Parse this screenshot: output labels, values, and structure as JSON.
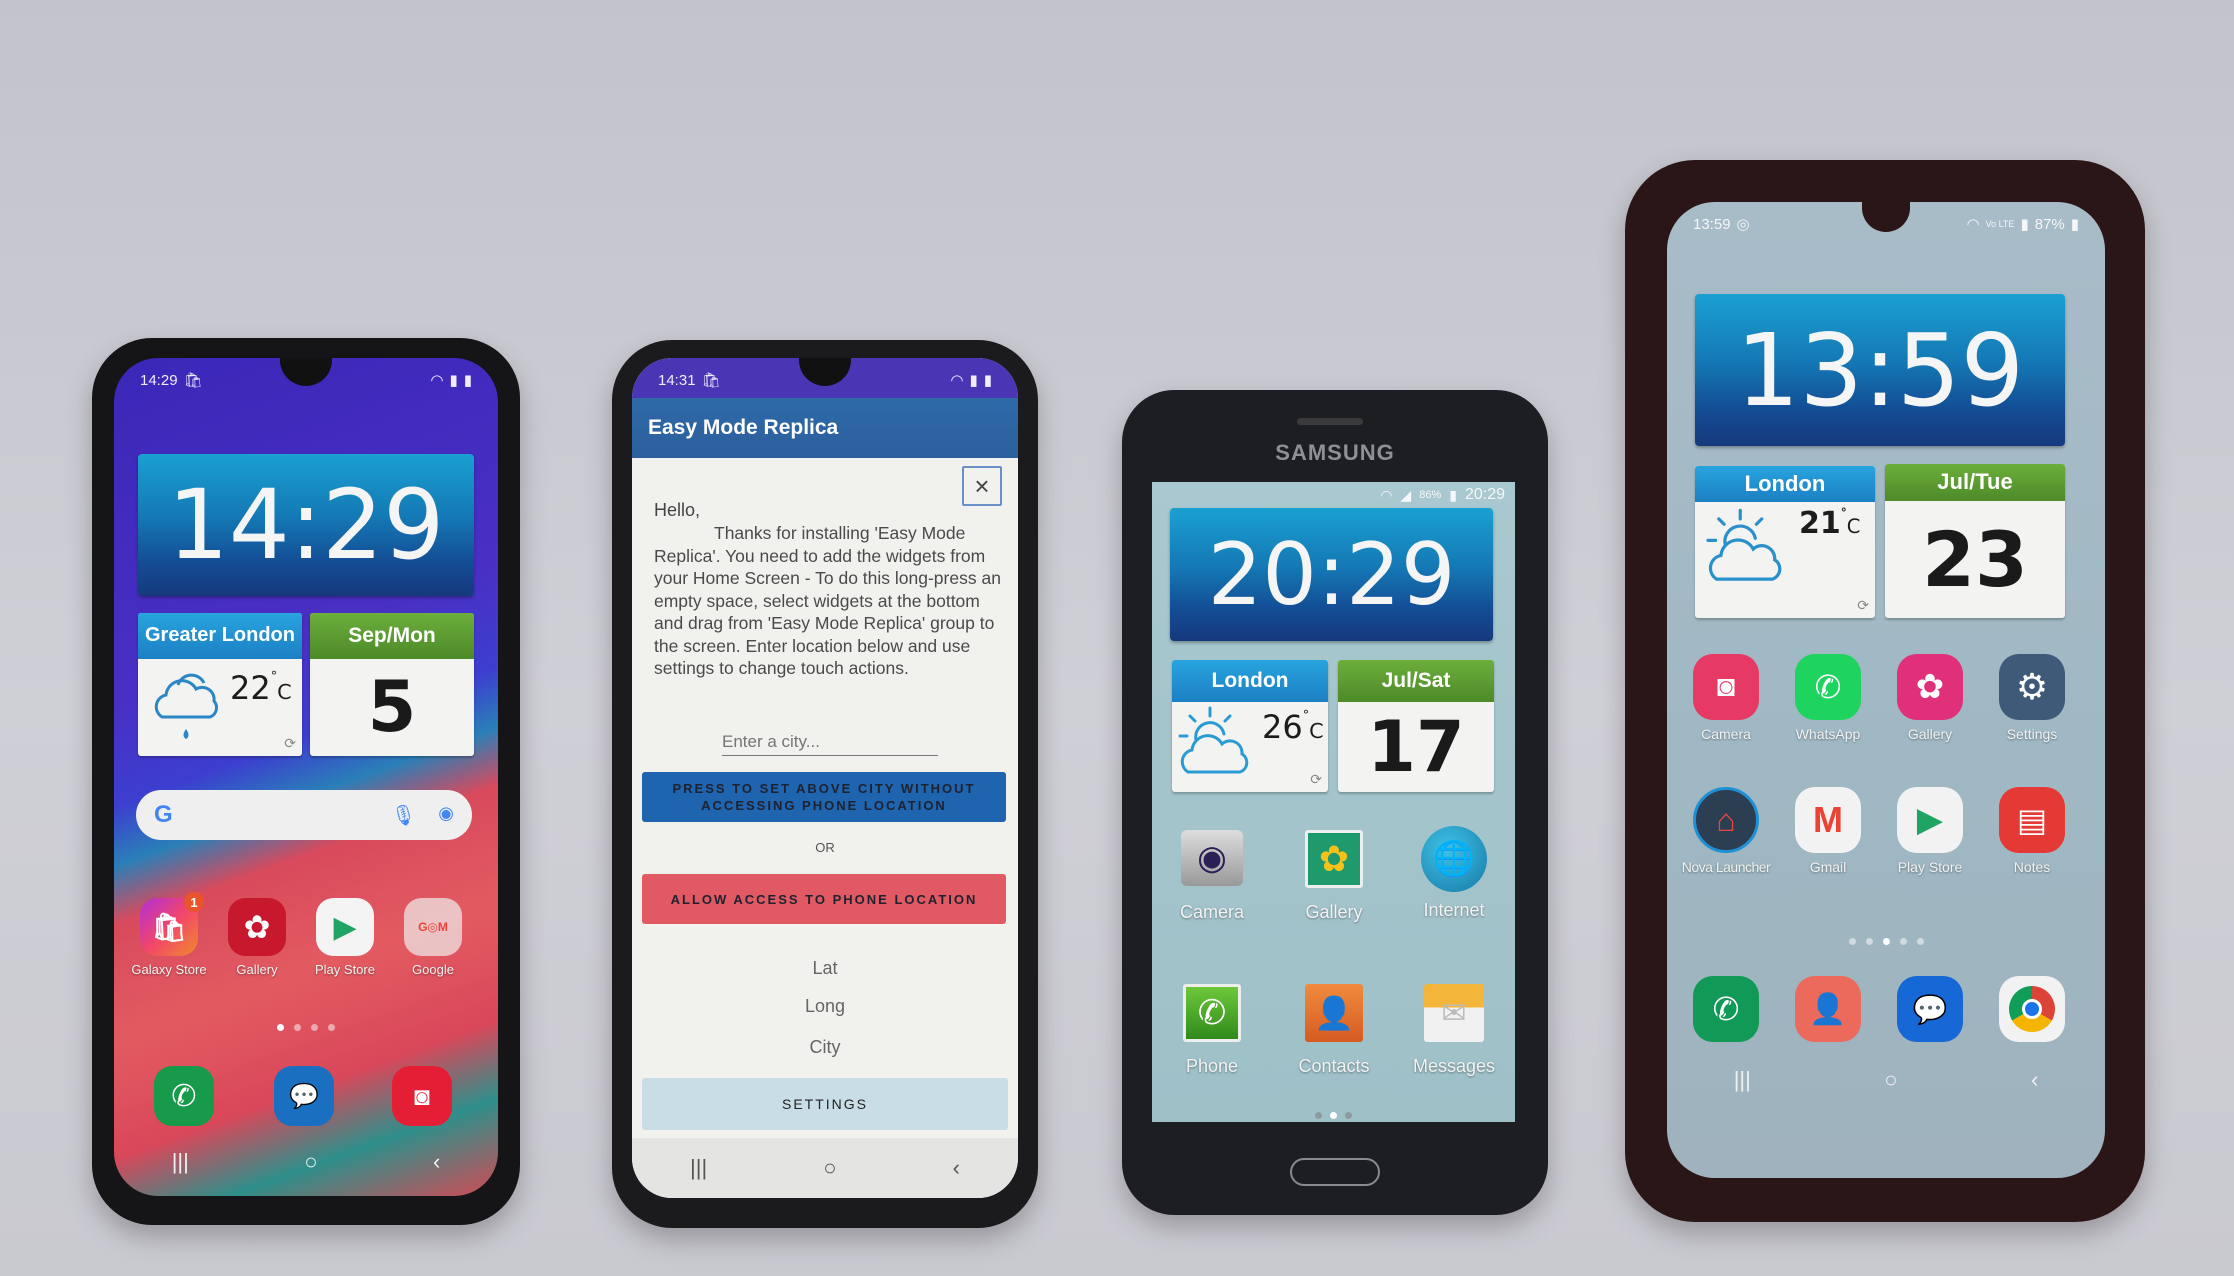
{
  "phones": [
    {
      "status": {
        "time": "14:29"
      },
      "clock": "14:29",
      "weather": {
        "location": "Greater London",
        "temp": "22",
        "unit": "C",
        "degree": "°",
        "condition": "rain-cloud-icon"
      },
      "calendar": {
        "header": "Sep/Mon",
        "day": "5"
      },
      "search": {
        "google_logo": "G"
      },
      "apps": [
        {
          "label": "Galaxy Store",
          "badge": "1"
        },
        {
          "label": "Gallery"
        },
        {
          "label": "Play Store"
        },
        {
          "label": "Google"
        }
      ],
      "dock": [
        "Phone",
        "Messages",
        "Camera"
      ],
      "nav": {
        "recents": "|||",
        "home": "○",
        "back": "‹"
      }
    },
    {
      "status": {
        "time": "14:31"
      },
      "app_title": "Easy Mode Replica",
      "close_label": "×",
      "greeting": "Hello,",
      "message": "Thanks for installing 'Easy Mode Replica'. You need to add the widgets from your Home Screen - To do this long-press an empty space, select widgets at the bottom and drag from 'Easy Mode Replica' group to the screen. Enter location below and use settings to change touch actions.",
      "city_input": {
        "placeholder": "Enter a city...",
        "value": ""
      },
      "set_city_button": "PRESS TO SET ABOVE CITY WITHOUT ACCESSING PHONE LOCATION",
      "or_label": "OR",
      "allow_location_button": "ALLOW ACCESS TO PHONE LOCATION",
      "lat_label": "Lat",
      "long_label": "Long",
      "city_label": "City",
      "settings_button": "SETTINGS",
      "nav": {
        "recents": "|||",
        "home": "○",
        "back": "‹"
      }
    },
    {
      "brand": "SAMSUNG",
      "status": {
        "battery": "86%",
        "time": "20:29"
      },
      "clock": "20:29",
      "weather": {
        "location": "London",
        "temp": "26",
        "unit": "C",
        "degree": "°",
        "condition": "partly-cloudy-icon"
      },
      "calendar": {
        "header": "Jul/Sat",
        "day": "17"
      },
      "apps": [
        {
          "label": "Camera"
        },
        {
          "label": "Gallery"
        },
        {
          "label": "Internet"
        },
        {
          "label": "Phone"
        },
        {
          "label": "Contacts"
        },
        {
          "label": "Messages"
        }
      ],
      "page_indicator": {
        "pages": 3,
        "current": 2
      }
    },
    {
      "status": {
        "time": "13:59",
        "battery": "87%"
      },
      "clock": "13:59",
      "weather": {
        "location": "London",
        "temp": "21",
        "unit": "C",
        "degree": "°",
        "condition": "partly-cloudy-icon"
      },
      "calendar": {
        "header": "Jul/Tue",
        "day": "23"
      },
      "apps": [
        {
          "label": "Camera"
        },
        {
          "label": "WhatsApp"
        },
        {
          "label": "Gallery"
        },
        {
          "label": "Settings"
        },
        {
          "label": "Nova Launcher"
        },
        {
          "label": "Gmail"
        },
        {
          "label": "Play Store"
        },
        {
          "label": "Notes"
        }
      ],
      "dock": [
        "Phone",
        "Contacts",
        "Messages",
        "Chrome"
      ],
      "page_indicator": {
        "pages": 5,
        "current": 3
      },
      "nav": {
        "recents": "|||",
        "home": "○",
        "back": "‹"
      }
    }
  ]
}
